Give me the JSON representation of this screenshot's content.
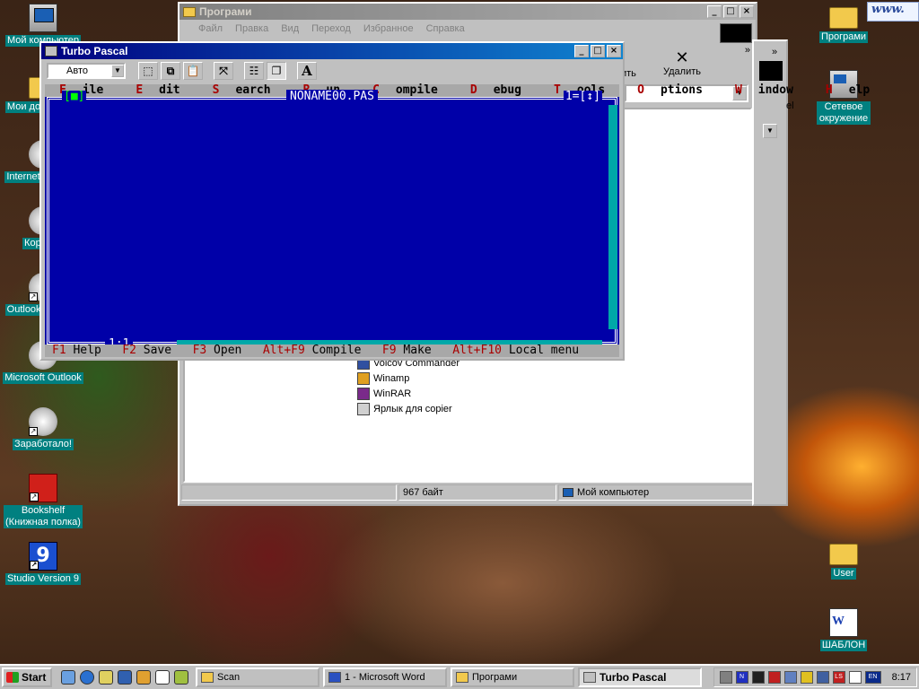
{
  "desktop": {
    "icons_left": [
      {
        "label": "Мой компьютер",
        "icon": "computer-icon"
      },
      {
        "label": "Мои документы",
        "icon": "folder-icon"
      },
      {
        "label": "Internet Explorer",
        "icon": "ie-icon"
      },
      {
        "label": "Корзина",
        "icon": "recycle-bin-icon"
      },
      {
        "label": "Outlook Express",
        "icon": "outlook-express-icon"
      },
      {
        "label": "Microsoft Outlook",
        "icon": "outlook-icon"
      },
      {
        "label": "Заработало!",
        "icon": "app-icon"
      },
      {
        "label": "Bookshelf\n(Книжная полка)",
        "icon": "bookshelf-icon"
      },
      {
        "label": "Studio Version 9",
        "icon": "studio-icon"
      }
    ],
    "icons_right": [
      {
        "label": "Програми",
        "icon": "folder-icon"
      },
      {
        "label": "Сетевое окружение",
        "icon": "network-icon"
      },
      {
        "label": "User",
        "icon": "folder-icon"
      },
      {
        "label": "ШАБЛОН",
        "icon": "word-doc-icon"
      }
    ],
    "banner_text": "www."
  },
  "explorer": {
    "title": "Програми",
    "menu": [
      "Файл",
      "Правка",
      "Вид",
      "Переход",
      "Избранное",
      "Справка"
    ],
    "toolbar_right": [
      "ить",
      "Удалить"
    ],
    "items": [
      "Volcov Commander",
      "Winamp",
      "WinRAR",
      "Ярлык для copier"
    ],
    "status": [
      "967 байт",
      "Мой компьютер"
    ]
  },
  "explorer2": {
    "fragment_label": "el"
  },
  "turbo_pascal": {
    "title": "Turbo Pascal",
    "font_select": "Авто",
    "toolbar_letter": "A",
    "menu": [
      {
        "hot": "F",
        "rest": "ile"
      },
      {
        "hot": "E",
        "rest": "dit"
      },
      {
        "hot": "S",
        "rest": "earch"
      },
      {
        "hot": "R",
        "rest": "un"
      },
      {
        "hot": "C",
        "rest": "ompile"
      },
      {
        "hot": "D",
        "rest": "ebug"
      },
      {
        "hot": "T",
        "rest": "ools"
      },
      {
        "hot": "O",
        "rest": "ptions"
      },
      {
        "hot": "W",
        "rest": "indow"
      },
      {
        "hot": "H",
        "rest": "elp"
      }
    ],
    "editor": {
      "filename": "NONAME00.PAS",
      "close_box": "[■]",
      "window_number": "1=[↕]",
      "cursor_pos": "1:1"
    },
    "status_bar": [
      {
        "key": "F1",
        "label": "Help"
      },
      {
        "key": "F2",
        "label": "Save"
      },
      {
        "key": "F3",
        "label": "Open"
      },
      {
        "key": "Alt+F9",
        "label": "Compile"
      },
      {
        "key": "F9",
        "label": "Make"
      },
      {
        "key": "Alt+F10",
        "label": "Local menu"
      }
    ]
  },
  "taskbar": {
    "start_label": "Start",
    "tasks": [
      {
        "label": "Scan",
        "active": false
      },
      {
        "label": "1 - Microsoft Word",
        "active": false
      },
      {
        "label": "Програми",
        "active": false
      },
      {
        "label": "Turbo Pascal",
        "active": true
      }
    ],
    "tray_lang": "EN",
    "clock": "8:17"
  }
}
